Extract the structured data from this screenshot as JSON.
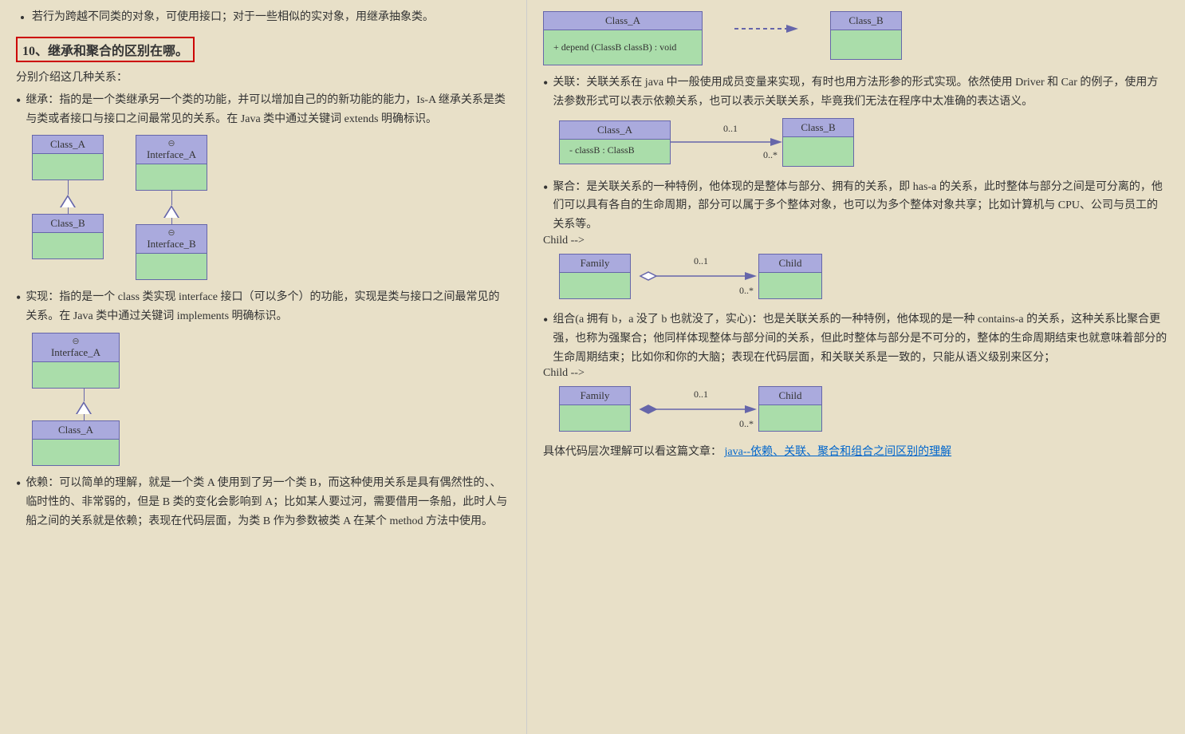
{
  "left": {
    "intro_bullet": "若行为跨越不同类的对象，可使用接口；对于一些相似的实对象，用继承抽象类。",
    "section_title": "10、继承和聚合的区别在哪。",
    "sub_intro": "分别介绍这几种关系：",
    "bullets": [
      {
        "id": "inherit",
        "dot": "•",
        "text": "继承：指的是一个类继承另一个类的功能，并可以增加自己的的新功能的能力，Is-A 继承关系是类与类或者接口与接口之间最常见的关系。在 Java 类中通过关键词 extends 明确标识。",
        "diagram_type": "inheritance"
      },
      {
        "id": "implement",
        "dot": "•",
        "text": "实现：指的是一个 class 类实现 interface 接口（可以多个）的功能，实现是类与接口之间最常见的关系。在 Java 类中通过关键词 implements 明确标识。",
        "diagram_type": "implementation"
      },
      {
        "id": "depend",
        "dot": "•",
        "text": "依赖：可以简单的理解，就是一个类 A 使用到了另一个类 B，而这种使用关系是具有偶然性的、、临时性的、非常弱的，但是 B 类的变化会影响到 A；比如某人要过河，需要借用一条船，此时人与船之间的关系就是依赖；表现在代码层面，为类 B 作为参数被类 A 在某个 method 方法中使用。",
        "diagram_type": "dependency"
      }
    ]
  },
  "right": {
    "bullets": [
      {
        "id": "association",
        "dot": "•",
        "text": "关联：关联关系在 java 中一般使用成员变量来实现，有时也用方法形参的形式实现。依然使用 Driver 和 Car 的例子，使用方法参数形式可以表示依赖关系，也可以表示关联关系，毕竟我们无法在程序中太准确的表达语义。",
        "diagram_type": "association"
      },
      {
        "id": "aggregation",
        "dot": "•",
        "text": "聚合：是关联关系的一种特例，他体现的是整体与部分、拥有的关系，即 has-a 的关系，此时整体与部分之间是可分离的，他们可以具有各自的生命周期，部分可以属于多个整体对象，也可以为多个整体对象共享；比如计算机与 CPU、公司与员工的关系等。",
        "diagram_type": "aggregation"
      },
      {
        "id": "composition",
        "dot": "•",
        "text": "组合(a 拥有 b，a 没了 b 也就没了，实心)：也是关联关系的一种特例，他体现的是一种 contains-a 的关系，这种关系比聚合更强，也称为强聚合；他同样体现整体与部分间的关系，但此时整体与部分是不可分的，整体的生命周期结束也就意味着部分的生命周期结束；比如你和你的大脑；表现在代码层面，和关联关系是一致的，只能从语义级别来区分；",
        "diagram_type": "composition"
      }
    ],
    "footer_text": "具体代码层次理解可以看这篇文章：java--依赖、关联、聚合和组合之间区别的理解",
    "footer_link": "java--依赖、关联、聚合和组合之间区别的理解"
  },
  "uml": {
    "class_a": "Class_A",
    "class_b": "Class_B",
    "interface_a": "Interface_A",
    "interface_b": "Interface_B",
    "family": "Family",
    "child": "Child",
    "depend_method": "+ depend (ClassB classB)  : void",
    "class_b_field": "- classB : ClassB",
    "mult_0_1": "0..1",
    "mult_0_n": "0..*"
  }
}
